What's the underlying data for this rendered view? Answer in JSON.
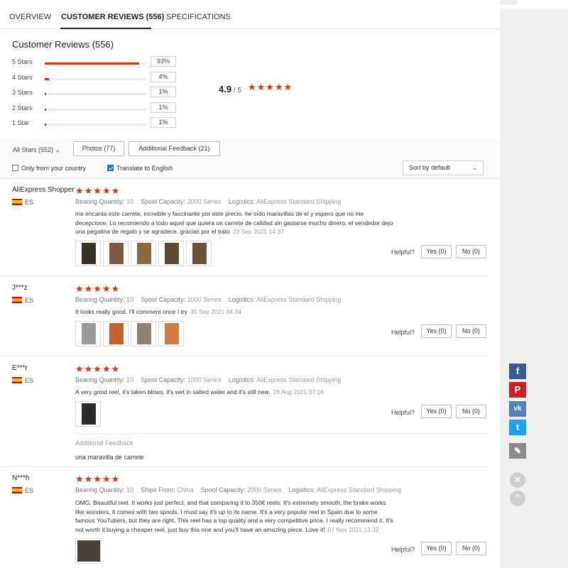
{
  "tabs": [
    {
      "label": "OVERVIEW"
    },
    {
      "label": "CUSTOMER REVIEWS (556)"
    },
    {
      "label": "SPECIFICATIONS"
    }
  ],
  "summary": {
    "title": "Customer Reviews (556)",
    "average": "4.9",
    "out_of": " / 5",
    "distribution": [
      {
        "label": "5 Stars",
        "pct": "93%",
        "value": 0.93
      },
      {
        "label": "4 Stars",
        "pct": "4%",
        "value": 0.04
      },
      {
        "label": "3 Stars",
        "pct": "1%",
        "value": 0.01
      },
      {
        "label": "2 Stars",
        "pct": "1%",
        "value": 0.01
      },
      {
        "label": "1 Star",
        "pct": "1%",
        "value": 0.01
      }
    ]
  },
  "filters": {
    "all_stars": "All Stars (552)",
    "photos": "Photos (77)",
    "additional": "Additional Feedback (21)",
    "only_country": "Only from your country",
    "translate": "Translate to English",
    "sort": "Sort by default"
  },
  "reviews": [
    {
      "name": "AliExpress Shopper",
      "country": "ES",
      "stars": "★★★★★",
      "attrs": [
        {
          "k": "Bearing Quantity:",
          "v": "10"
        },
        {
          "k": "Spool Capacity:",
          "v": "2000 Series"
        },
        {
          "k": "Logistics:",
          "v": "AliExpress Standard Shipping"
        }
      ],
      "text_lines": [
        "me encanta este carrete, increible y fascinante por este precio. he oído maravillas de el y espero que no me",
        "decepcione. Lo recomiendo a todo aquel que quiera un carrete de calidad sin gastarse mucho dinero. el vendedor dejo",
        "una pegatina de regalo y se agradece. gracias por el trato"
      ],
      "date": "23 Sep 2021 14:37",
      "helpful": "Helpful?",
      "yes": "Yes (0)",
      "no": "No (0)"
    },
    {
      "name": "J***z",
      "country": "ES",
      "stars": "★★★★★",
      "attrs": [
        {
          "k": "Bearing Quantity:",
          "v": "10"
        },
        {
          "k": "Spool Capacity:",
          "v": "1000 Series"
        },
        {
          "k": "Logistics:",
          "v": "AliExpress Standard Shipping"
        }
      ],
      "text_lines": [
        "It looks really good. I'll comment once I try"
      ],
      "date": "30 Sep 2021 04:34",
      "helpful": "Helpful?",
      "yes": "Yes (0)",
      "no": "No (0)"
    },
    {
      "name": "E***r",
      "country": "ES",
      "stars": "★★★★★",
      "attrs": [
        {
          "k": "Bearing Quantity:",
          "v": "10"
        },
        {
          "k": "Spool Capacity:",
          "v": "1000 Series"
        },
        {
          "k": "Logistics:",
          "v": "AliExpress Standard Shipping"
        }
      ],
      "text_lines": [
        "A very good reel, it's taken blows, it's wet in salted water and it's still new."
      ],
      "date": "26 Aug 2021 07:16",
      "helpful": "Helpful?",
      "yes": "Yes (0)",
      "no": "No (0)",
      "additional_title": "Additional Feedback",
      "additional_text": "una maravilla de carrete"
    },
    {
      "name": "N***h",
      "country": "ES",
      "stars": "★★★★★",
      "attrs": [
        {
          "k": "Bearing Quantity:",
          "v": "10"
        },
        {
          "k": "Ships From:",
          "v": "China"
        },
        {
          "k": "Spool Capacity:",
          "v": "2000 Series"
        },
        {
          "k": "Logistics:",
          "v": "AliExpress Standard Shipping"
        }
      ],
      "text_lines": [
        "OMG. Beautiful reel. It works just perfect, and that comparing it to 350€ reels. It's extremely smooth, the brake works",
        "like wonders, it comes with two spools. I must say it's up to its name. It's a very popular reel in Spain due to some",
        "famous YouTubers, but they are right. This reel has a top quality and a very competitive price. I really recommend it. It's",
        "not worth it buying a cheaper reel, just buy this one and you'll have an amazing piece. Love it!"
      ],
      "date": "07 Nov 2021 13:32",
      "helpful": "Helpful?",
      "yes": "Yes (0)",
      "no": "No (0)"
    }
  ],
  "social": {
    "facebook": "f",
    "pinterest": "P",
    "vk": "vk",
    "twitter": "t",
    "edit": "✎",
    "close": "✕",
    "up": "⌃"
  },
  "colors": {
    "accent": "#e62e04",
    "facebook": "#3b5998",
    "pinterest": "#cb2027",
    "vk": "#5181b8",
    "twitter": "#1da1f2",
    "edit": "#8a8a8a"
  }
}
